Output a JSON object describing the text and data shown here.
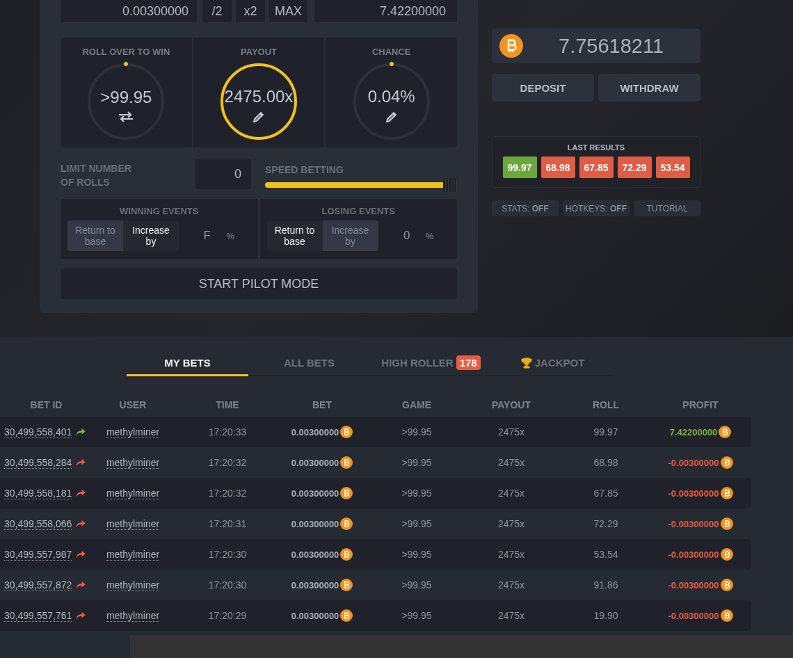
{
  "bet": {
    "amount": "0.00300000",
    "modifiers": [
      "/2",
      "x2",
      "MAX"
    ],
    "profit": "7.42200000"
  },
  "dials": [
    {
      "label": "ROLL OVER TO WIN",
      "value": ">99.95",
      "kind": "swap",
      "highlighted": false
    },
    {
      "label": "PAYOUT",
      "value": "2475.00x",
      "kind": "edit",
      "highlighted": true
    },
    {
      "label": "CHANCE",
      "value": "0.04%",
      "kind": "edit",
      "highlighted": false
    }
  ],
  "limit": {
    "label": "LIMIT NUMBER OF ROLLS",
    "value": "0"
  },
  "speed": {
    "label": "SPEED BETTING",
    "level": 1
  },
  "events": [
    {
      "title": "WINNING EVENTS",
      "options": [
        {
          "label": "Return to base",
          "selected": false
        },
        {
          "label": "Increase by",
          "selected": true
        }
      ],
      "value": "F",
      "unit": "%"
    },
    {
      "title": "LOSING EVENTS",
      "options": [
        {
          "label": "Return to base",
          "selected": true
        },
        {
          "label": "Increase by",
          "selected": false
        }
      ],
      "value": "0",
      "unit": "%"
    }
  ],
  "start_button": "START PILOT MODE",
  "balance": "7.75618211",
  "wallet_buttons": [
    "DEPOSIT",
    "WITHDRAW"
  ],
  "last_results": {
    "title": "LAST RESULTS",
    "items": [
      {
        "value": "99.97",
        "color": "#6aa83e"
      },
      {
        "value": "68.98",
        "color": "#df5c45"
      },
      {
        "value": "67.85",
        "color": "#df5c45"
      },
      {
        "value": "72.29",
        "color": "#df5c45"
      },
      {
        "value": "53.54",
        "color": "#df5c45"
      }
    ]
  },
  "toggles": [
    "STATS: **OFF**",
    "HOTKEYS: **OFF**",
    "TUTORIAL"
  ],
  "tabs": [
    {
      "label": "MY BETS",
      "selected": true
    },
    {
      "label": "ALL BETS",
      "selected": false
    },
    {
      "label": "HIGH ROLLER",
      "selected": false,
      "badge": "178"
    },
    {
      "label": "JACKPOT",
      "selected": false,
      "kind": "trophy"
    }
  ],
  "table": {
    "columns": [
      "BET ID",
      "USER",
      "TIME",
      "BET",
      "GAME",
      "PAYOUT",
      "ROLL",
      "PROFIT"
    ],
    "rows": [
      {
        "bet_id": "30,499,558,401",
        "won": true,
        "user": "methylminer",
        "time": "17:20:33",
        "bet": "0.00300000",
        "game": ">99.95",
        "payout": "2475x",
        "roll": "99.97",
        "profit": "7.42200000"
      },
      {
        "bet_id": "30,499,558,284",
        "won": false,
        "user": "methylminer",
        "time": "17:20:32",
        "bet": "0.00300000",
        "game": ">99.95",
        "payout": "2475x",
        "roll": "68.98",
        "profit": "-0.00300000"
      },
      {
        "bet_id": "30,499,558,181",
        "won": false,
        "user": "methylminer",
        "time": "17:20:32",
        "bet": "0.00300000",
        "game": ">99.95",
        "payout": "2475x",
        "roll": "67.85",
        "profit": "-0.00300000"
      },
      {
        "bet_id": "30,499,558,066",
        "won": false,
        "user": "methylminer",
        "time": "17:20:31",
        "bet": "0.00300000",
        "game": ">99.95",
        "payout": "2475x",
        "roll": "72.29",
        "profit": "-0.00300000"
      },
      {
        "bet_id": "30,499,557,987",
        "won": false,
        "user": "methylminer",
        "time": "17:20:30",
        "bet": "0.00300000",
        "game": ">99.95",
        "payout": "2475x",
        "roll": "53.54",
        "profit": "-0.00300000"
      },
      {
        "bet_id": "30,499,557,872",
        "won": false,
        "user": "methylminer",
        "time": "17:20:30",
        "bet": "0.00300000",
        "game": ">99.95",
        "payout": "2475x",
        "roll": "91.86",
        "profit": "-0.00300000"
      },
      {
        "bet_id": "30,499,557,761",
        "won": false,
        "user": "methylminer",
        "time": "17:20:29",
        "bet": "0.00300000",
        "game": ">99.95",
        "payout": "2475x",
        "roll": "19.90",
        "profit": "-0.00300000"
      }
    ]
  }
}
